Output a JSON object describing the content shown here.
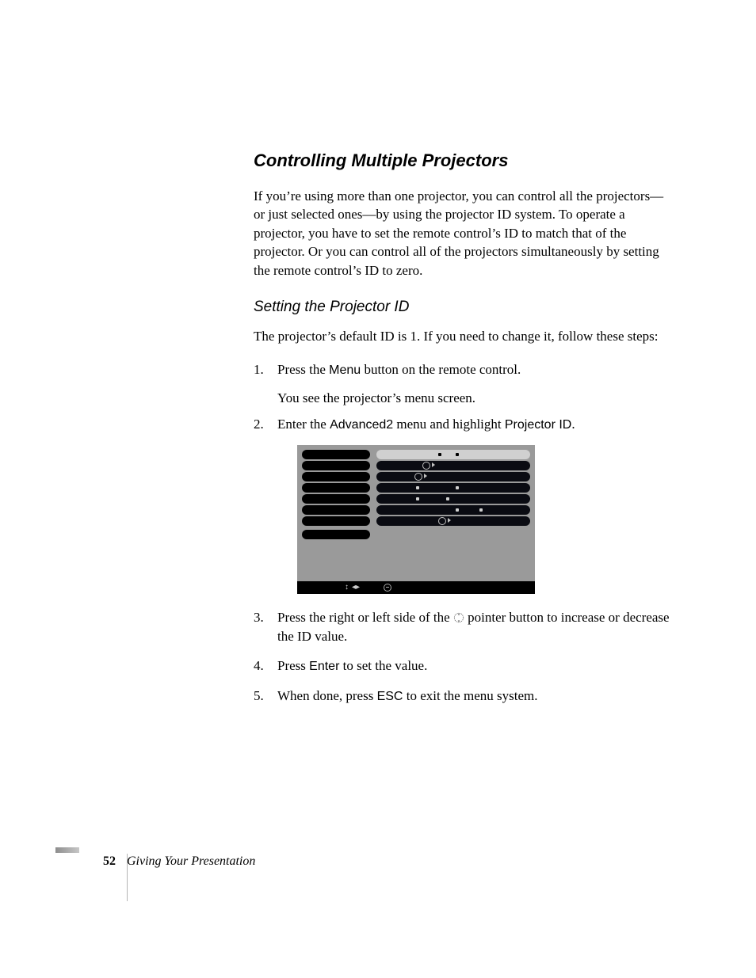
{
  "heading": "Controlling Multiple Projectors",
  "intro": "If you’re using more than one projector, you can control all the projectors—or just selected ones—by using the projector ID system. To operate a projector, you have to set the remote control’s ID to match that of the projector. Or you can control all of the projectors simultaneously by setting the remote control’s ID to zero.",
  "subheading": "Setting the Projector ID",
  "subintro": "The projector’s default ID is 1. If you need to change it, follow these steps:",
  "steps": {
    "s1": {
      "num": "1.",
      "pre": "Press the ",
      "btn": "Menu",
      "post": " button on the remote control."
    },
    "s1_sub": "You see the projector’s menu screen.",
    "s2": {
      "num": "2.",
      "pre": "Enter the ",
      "m1": "Advanced2",
      "mid": " menu and highlight ",
      "m2": "Projector ID",
      "post": "."
    },
    "s3": {
      "num": "3.",
      "pre": "Press the right or left side of the ",
      "post": " pointer button to increase or decrease the ID value."
    },
    "s4": {
      "num": "4.",
      "pre": "Press ",
      "btn": "Enter",
      "post": " to set the value."
    },
    "s5": {
      "num": "5.",
      "pre": "When done, press ",
      "btn": "ESC",
      "post": " to exit the menu system."
    }
  },
  "footer": {
    "page": "52",
    "title": "Giving Your Presentation"
  }
}
